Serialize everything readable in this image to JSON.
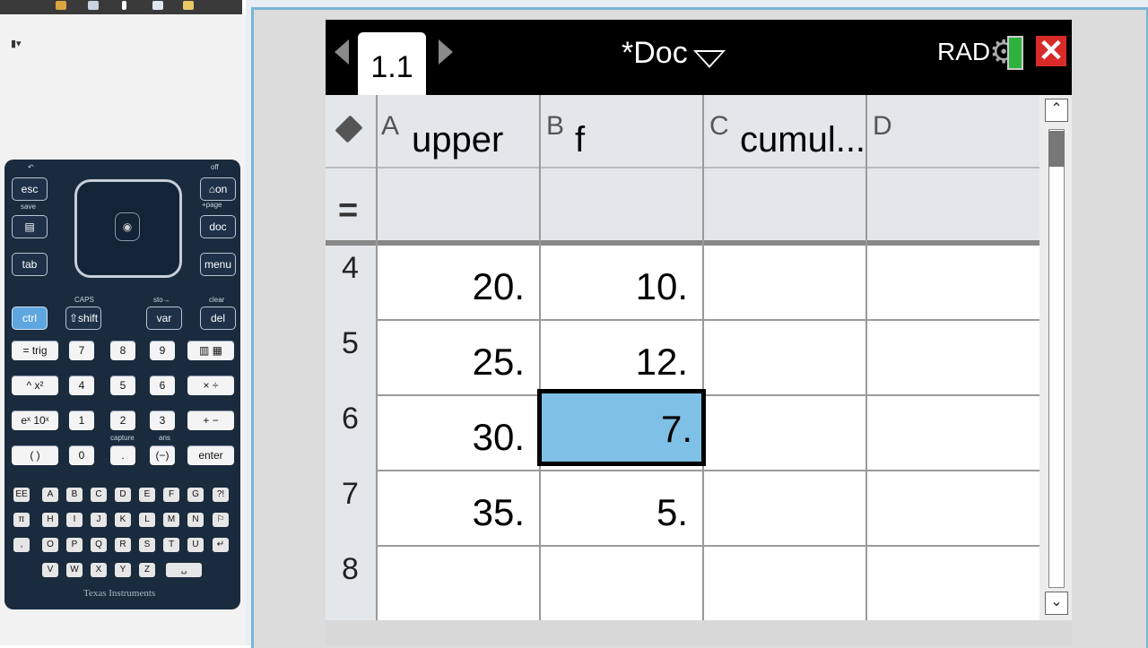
{
  "toolbar_icons": [
    "scissors-icon",
    "copy-icon",
    "pen-icon",
    "screen-icon",
    "folder-icon"
  ],
  "keypad": {
    "esc": "esc",
    "on": "on",
    "off": "off",
    "save": "save",
    "page": "+page",
    "doc": "doc",
    "tab": "tab",
    "menu": "menu",
    "caps": "CAPS",
    "sto": "sto→",
    "clear": "clear",
    "ctrl": "ctrl",
    "shift": "shift",
    "var": "var",
    "del": "del",
    "trig": "trig",
    "eq": "=",
    "caret": "^",
    "x2": "x²",
    "ex": "eˣ",
    "tenx": "10ˣ",
    "paren": "(  )",
    "mul": "×",
    "div": "÷",
    "plus": "+",
    "minus": "−",
    "neg": "(−)",
    "enter": "enter",
    "capture": "capture",
    "ans": "ans",
    "ee": "EE",
    "digits": [
      "7",
      "8",
      "9",
      "4",
      "5",
      "6",
      "1",
      "2",
      "3",
      "0",
      "."
    ],
    "alpha_rows": [
      [
        "A",
        "B",
        "C",
        "D",
        "E",
        "F",
        "G"
      ],
      [
        "H",
        "I",
        "J",
        "K",
        "L",
        "M",
        "N"
      ],
      [
        "O",
        "P",
        "Q",
        "R",
        "S",
        "T",
        "U"
      ],
      [
        "V",
        "W",
        "X",
        "Y",
        "Z"
      ]
    ],
    "brand": "Texas Instruments"
  },
  "app": {
    "tab_label": "1.1",
    "doc_title": "*Doc",
    "angle_mode": "RAD"
  },
  "spreadsheet": {
    "columns": [
      {
        "letter": "A",
        "name": "upper"
      },
      {
        "letter": "B",
        "name": "f"
      },
      {
        "letter": "C",
        "name": "cumul..."
      },
      {
        "letter": "D",
        "name": ""
      }
    ],
    "formula_row_symbol": "=",
    "rows": [
      {
        "num": "4",
        "a": "20.",
        "b": "10.",
        "c": "",
        "d": ""
      },
      {
        "num": "5",
        "a": "25.",
        "b": "12.",
        "c": "",
        "d": ""
      },
      {
        "num": "6",
        "a": "30.",
        "b": "7.",
        "c": "",
        "d": ""
      },
      {
        "num": "7",
        "a": "35.",
        "b": "5.",
        "c": "",
        "d": ""
      },
      {
        "num": "8",
        "a": "",
        "b": "",
        "c": "",
        "d": ""
      }
    ],
    "selected_cell": "B6"
  },
  "colors": {
    "selection": "#7ec0e6",
    "frame_border": "#79b5d8",
    "close_button": "#d92a2a",
    "battery": "#2fb13e"
  }
}
